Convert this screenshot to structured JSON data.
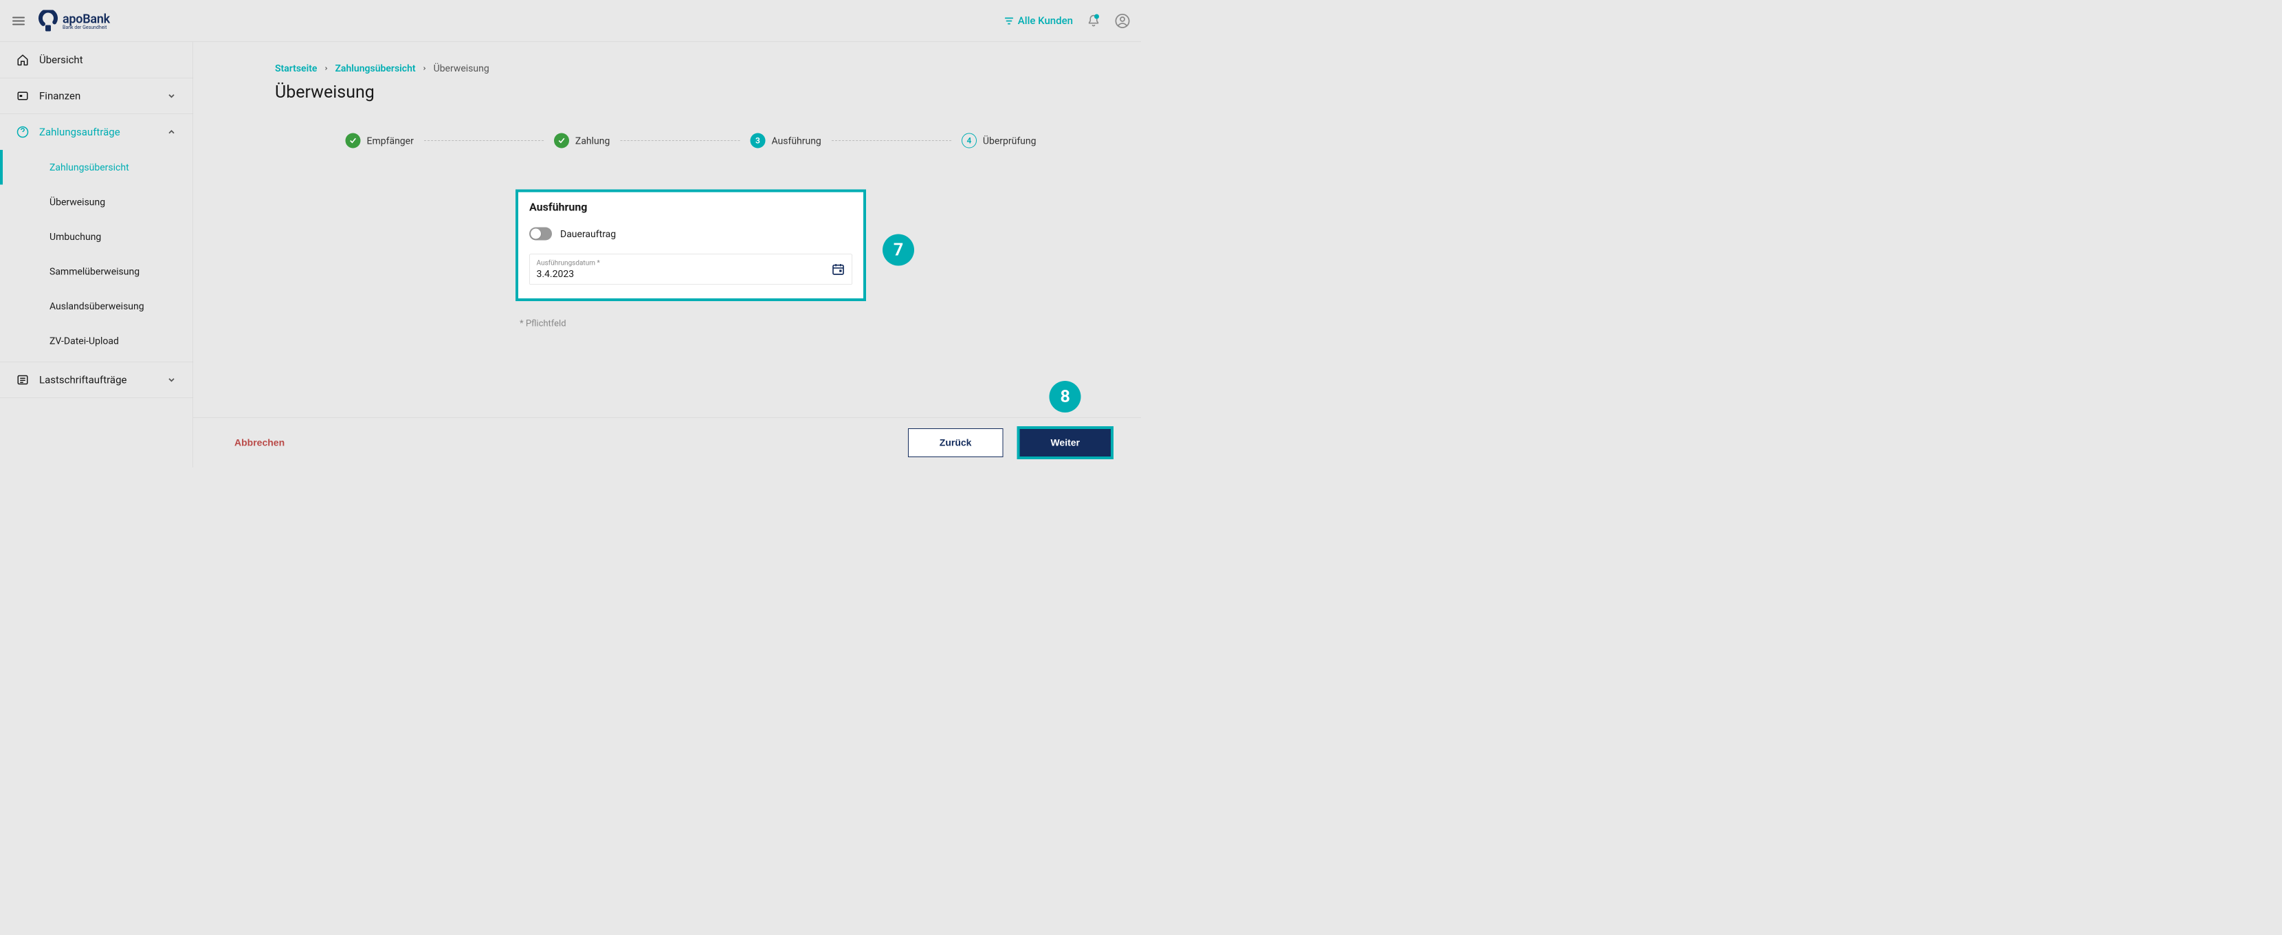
{
  "header": {
    "brand_main": "apoBank",
    "brand_sub": "Bank der Gesundheit",
    "filter_label": "Alle Kunden"
  },
  "sidebar": {
    "overview": "Übersicht",
    "finances": "Finanzen",
    "payments": {
      "title": "Zahlungsaufträge",
      "items": [
        "Zahlungsübersicht",
        "Überweisung",
        "Umbuchung",
        "Sammelüberweisung",
        "Auslandsüberweisung",
        "ZV-Datei-Upload"
      ]
    },
    "debits": "Lastschriftaufträge"
  },
  "breadcrumb": {
    "home": "Startseite",
    "level1": "Zahlungsübersicht",
    "current": "Überweisung"
  },
  "page_title": "Überweisung",
  "stepper": {
    "s1": "Empfänger",
    "s2": "Zahlung",
    "s3_num": "3",
    "s3": "Ausführung",
    "s4_num": "4",
    "s4": "Überprüfung"
  },
  "card": {
    "title": "Ausführung",
    "toggle_label": "Dauerauftrag",
    "date_label": "Ausführungsdatum *",
    "date_value": "3.4.2023"
  },
  "hint": "* Pflichtfeld",
  "footer": {
    "cancel": "Abbrechen",
    "back": "Zurück",
    "next": "Weiter"
  },
  "badges": {
    "b7": "7",
    "b8": "8"
  }
}
